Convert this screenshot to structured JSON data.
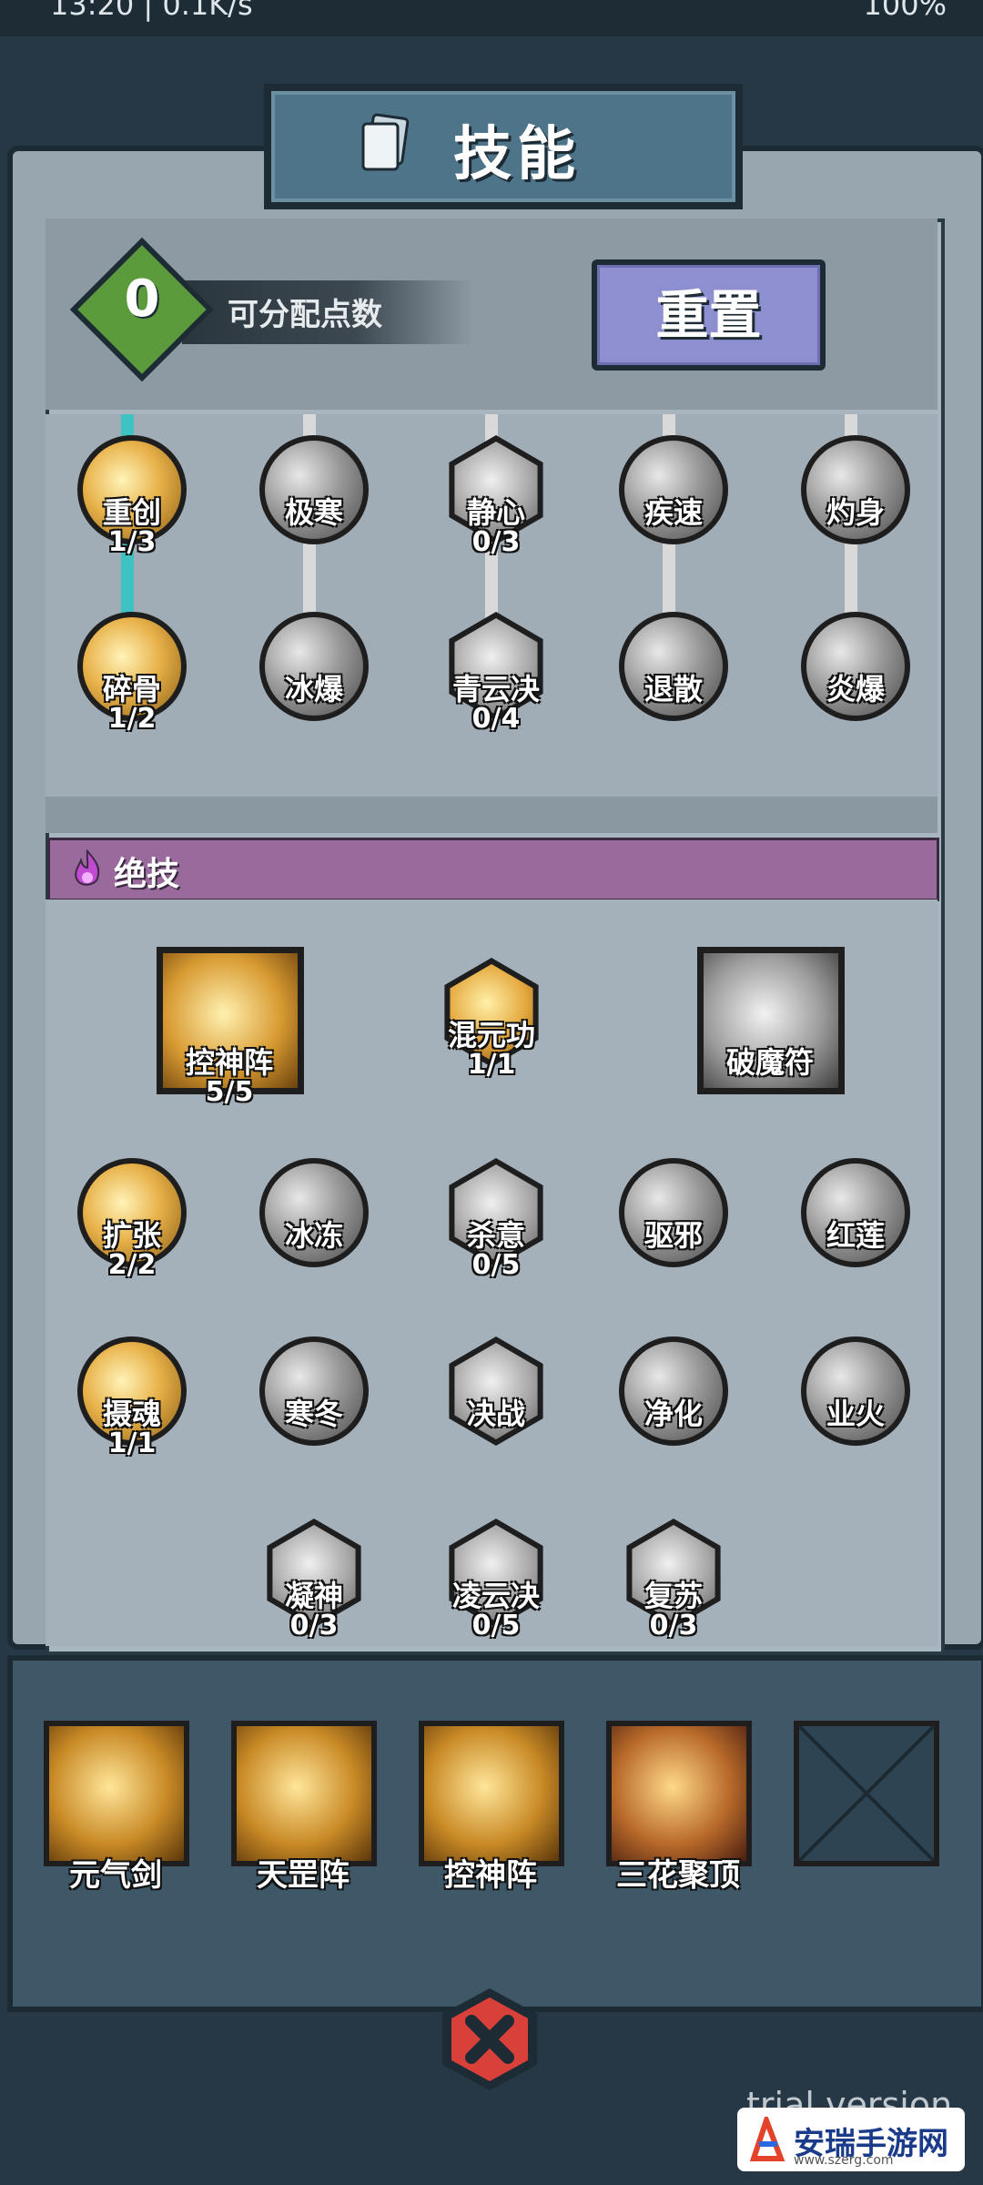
{
  "status_bar": {
    "left": "13:20 | 0.1K/s",
    "right": "100%"
  },
  "title": "技能",
  "points": {
    "value": "0",
    "label": "可分配点数"
  },
  "reset_label": "重置",
  "tree1": [
    {
      "name": "重创",
      "level": "1/3",
      "shape": "circle",
      "tone": "gold"
    },
    {
      "name": "极寒",
      "level": "",
      "shape": "circle",
      "tone": "gray"
    },
    {
      "name": "静心",
      "level": "0/3",
      "shape": "hex",
      "tone": "gray"
    },
    {
      "name": "疾速",
      "level": "",
      "shape": "circle",
      "tone": "gray"
    },
    {
      "name": "灼身",
      "level": "",
      "shape": "circle",
      "tone": "gray"
    },
    {
      "name": "碎骨",
      "level": "1/2",
      "shape": "circle",
      "tone": "gold"
    },
    {
      "name": "冰爆",
      "level": "",
      "shape": "circle",
      "tone": "gray"
    },
    {
      "name": "青云决",
      "level": "0/4",
      "shape": "hex",
      "tone": "gray"
    },
    {
      "name": "退散",
      "level": "",
      "shape": "circle",
      "tone": "gray"
    },
    {
      "name": "炎爆",
      "level": "",
      "shape": "circle",
      "tone": "gray"
    }
  ],
  "ultimate_label": "绝技",
  "tree2": [
    {
      "name": "控神阵",
      "level": "5/5",
      "shape": "square",
      "tone": "gold"
    },
    {
      "name": "混元功",
      "level": "1/1",
      "shape": "hex",
      "tone": "gold"
    },
    {
      "name": "破魔符",
      "level": "",
      "shape": "square",
      "tone": "gray"
    },
    {
      "name": "扩张",
      "level": "2/2",
      "shape": "circle",
      "tone": "gold"
    },
    {
      "name": "冰冻",
      "level": "",
      "shape": "circle",
      "tone": "gray"
    },
    {
      "name": "杀意",
      "level": "0/5",
      "shape": "hex",
      "tone": "gray"
    },
    {
      "name": "驱邪",
      "level": "",
      "shape": "circle",
      "tone": "gray"
    },
    {
      "name": "红莲",
      "level": "",
      "shape": "circle",
      "tone": "gray"
    },
    {
      "name": "摄魂",
      "level": "1/1",
      "shape": "circle",
      "tone": "gold"
    },
    {
      "name": "寒冬",
      "level": "",
      "shape": "circle",
      "tone": "gray"
    },
    {
      "name": "决战",
      "level": "",
      "shape": "hex",
      "tone": "gray"
    },
    {
      "name": "净化",
      "level": "",
      "shape": "circle",
      "tone": "gray"
    },
    {
      "name": "业火",
      "level": "",
      "shape": "circle",
      "tone": "gray"
    },
    {
      "name": "凝神",
      "level": "0/3",
      "shape": "hex",
      "tone": "gray"
    },
    {
      "name": "凌云决",
      "level": "0/5",
      "shape": "hex",
      "tone": "gray"
    },
    {
      "name": "复苏",
      "level": "0/3",
      "shape": "hex",
      "tone": "gray"
    }
  ],
  "equipped": [
    {
      "name": "元气剑",
      "icon": "sword-icon"
    },
    {
      "name": "天罡阵",
      "icon": "yinyang-icon"
    },
    {
      "name": "控神阵",
      "icon": "orb-icon"
    },
    {
      "name": "三花聚顶",
      "icon": "lotus-icon"
    },
    {
      "name": "",
      "icon": "empty-slot-icon"
    }
  ],
  "watermark": {
    "title": "安瑞手游网",
    "url": "www.szerg.com"
  },
  "trial_text": "trial version",
  "colors": {
    "link_active": "#3fc2c2",
    "link_inactive": "#d9d9d9",
    "reset_button": "#8d8fd0",
    "points_diamond": "#5b9b3c",
    "ultimate_bar": "#9a6a9c"
  }
}
